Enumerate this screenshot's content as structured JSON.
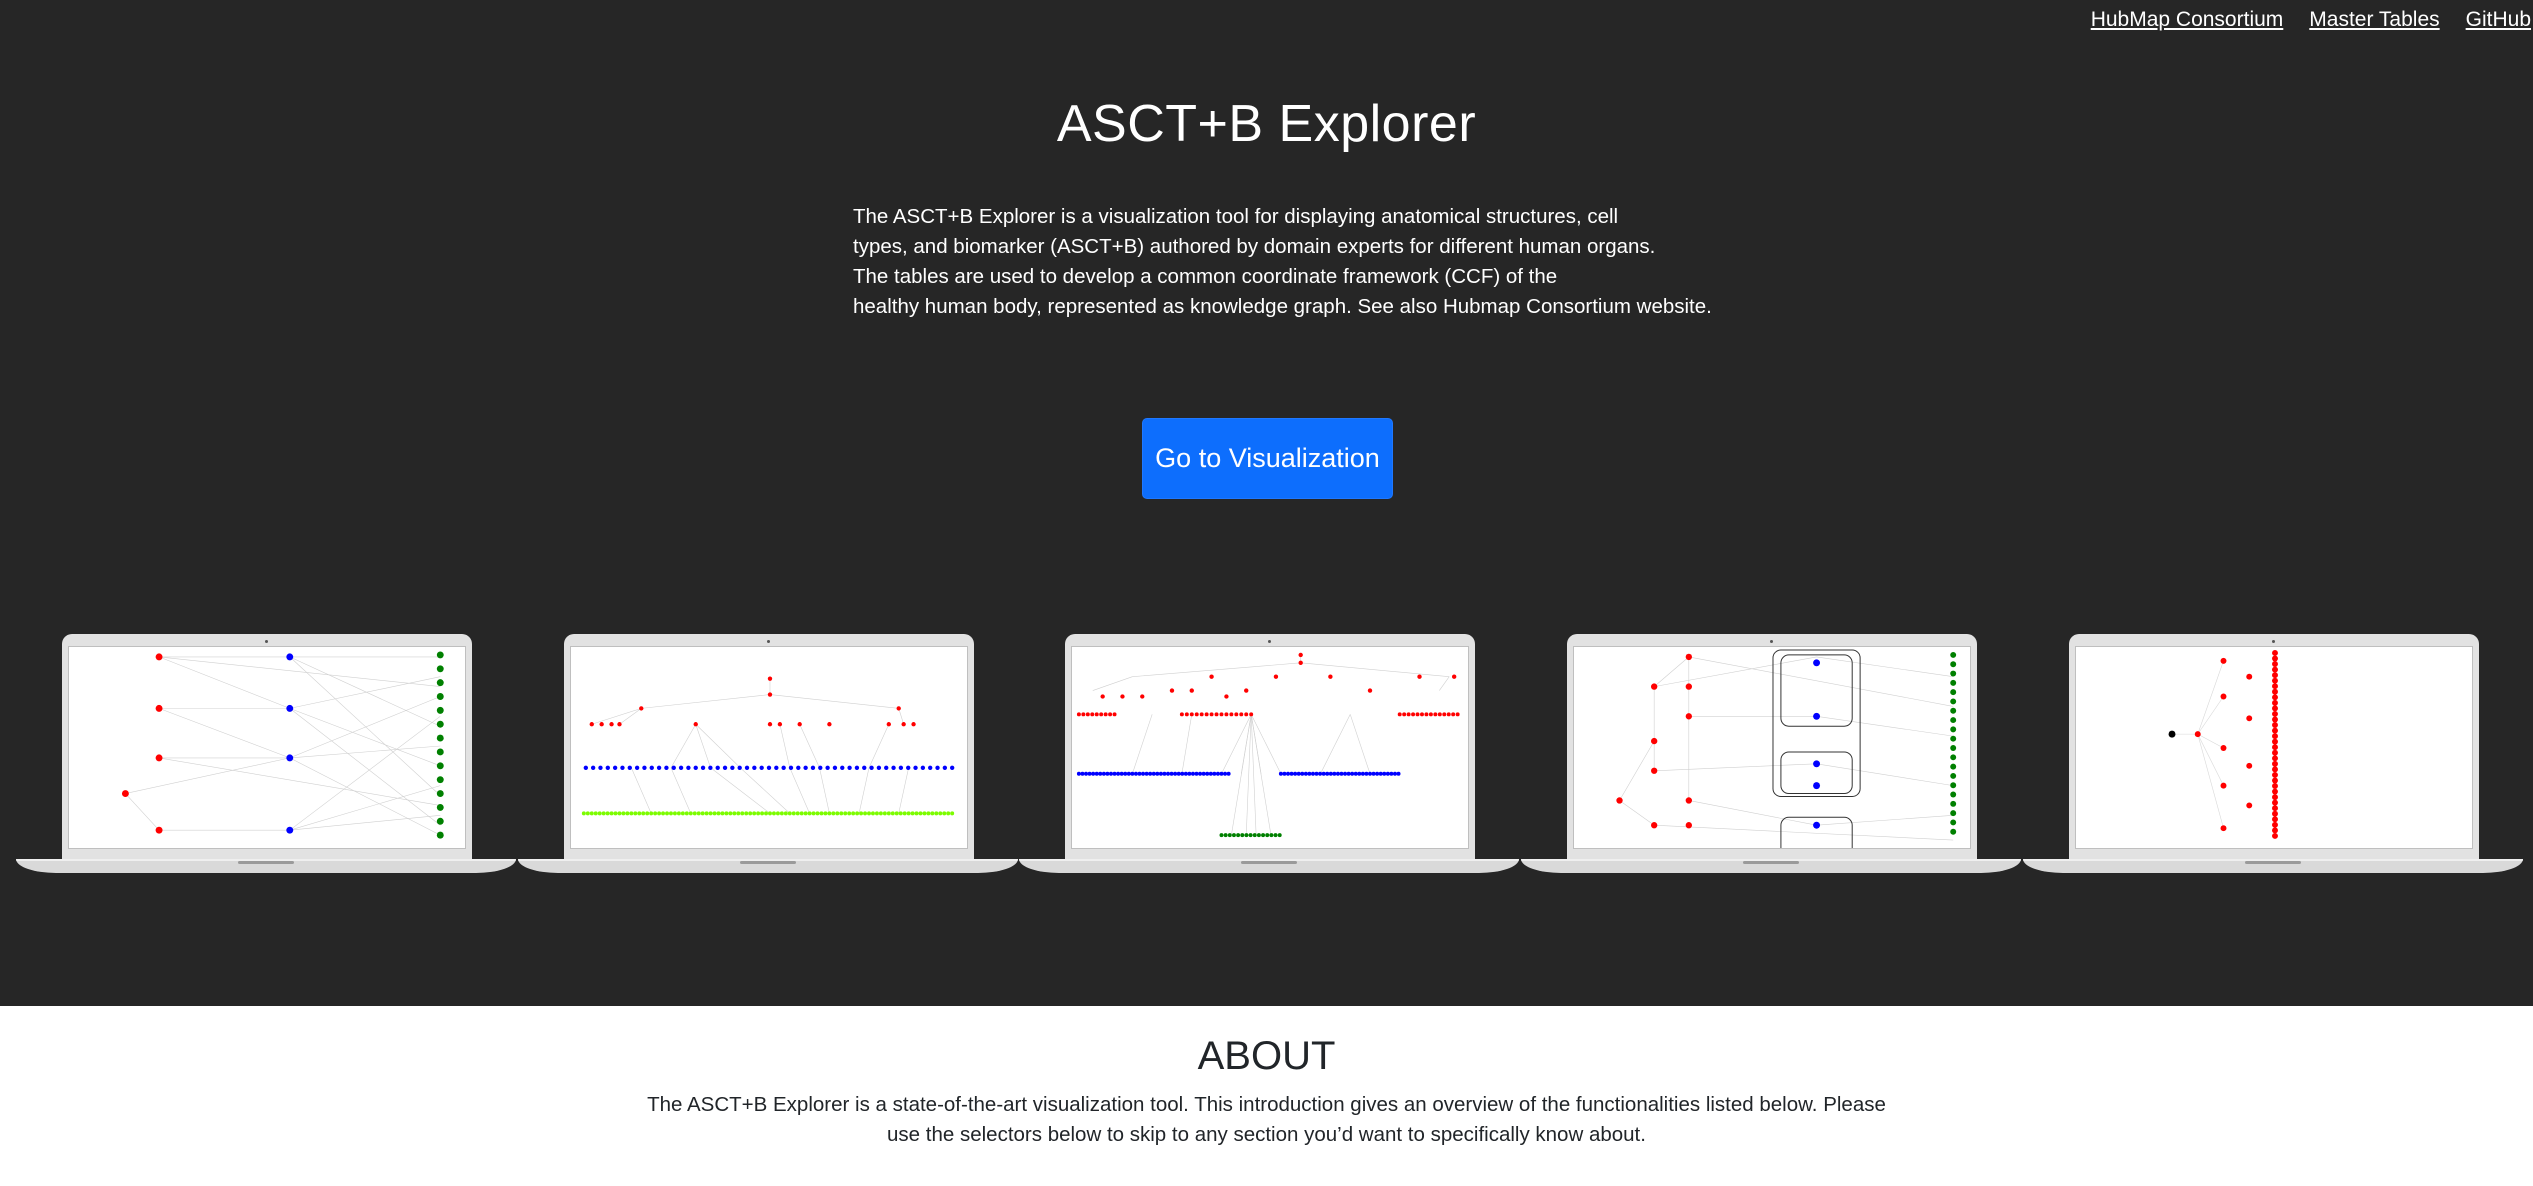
{
  "nav": {
    "links": [
      "HubMap Consortium",
      "Master Tables",
      "GitHub"
    ]
  },
  "hero": {
    "title": "ASCT+B Explorer",
    "intro_lines": [
      "The ASCT+B Explorer is a visualization tool for displaying anatomical structures, cell",
      "types, and biomarker (ASCT+B) authored by domain experts for different human organs.",
      "The tables are used to develop a common coordinate framework (CCF) of the",
      "healthy human body, represented as knowledge graph. See also Hubmap Consortium website."
    ],
    "cta_label": "Go to Visualization",
    "laptop_previews": [
      "laptop-preview-layered-graph",
      "laptop-preview-tree-layout",
      "laptop-preview-hierarchy-layout",
      "laptop-preview-grouped-graph",
      "laptop-preview-radial-tree"
    ]
  },
  "about": {
    "heading": "ABOUT",
    "lines": [
      "The ASCT+B Explorer is a state-of-the-art visualization tool. This introduction gives an overview of the functionalities listed below. Please",
      "use the selectors below to skip to any section you’d want to specifically know about."
    ]
  },
  "colors": {
    "hero_background": "#262626",
    "cta_background": "#0d6efd",
    "anatomical_structure_node": "#ff0000",
    "cell_type_node": "#0000ff",
    "biomarker_node": "#008000",
    "biomarker_node_alt": "#7cfc00"
  }
}
